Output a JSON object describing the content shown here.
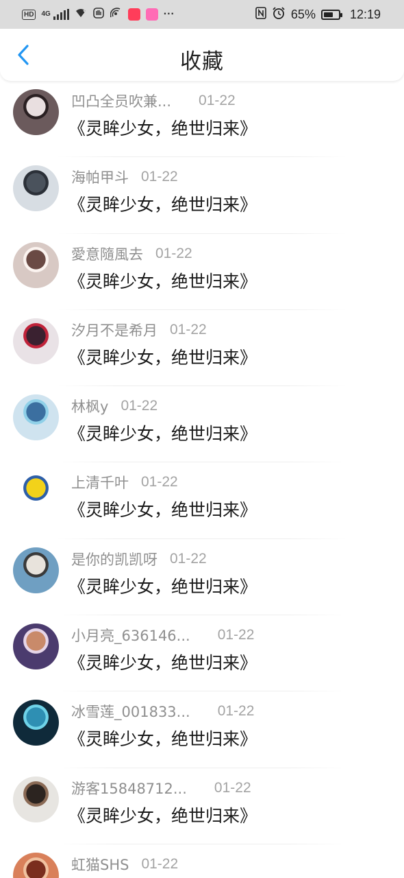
{
  "status_bar": {
    "hd": "HD",
    "network": "4G",
    "battery_percent": "65%",
    "battery_level": 0.65,
    "time": "12:19",
    "more": "···",
    "icons": [
      "hd-icon",
      "signal-icon",
      "wifi-icon",
      "hand-icon",
      "hotspot-icon",
      "app-icon-red",
      "app-icon-pink",
      "nfc-icon",
      "alarm-icon",
      "battery-icon"
    ]
  },
  "header": {
    "title": "收藏",
    "back_icon": "chevron-left-icon",
    "accent_color": "#2196f3"
  },
  "items": [
    {
      "name": "凹凸全员吹兼...",
      "date": "01-22",
      "content": "《灵眸少女，绝世归来》",
      "avatar": {
        "bg": "#6b5a5c",
        "fg": "#e9dfe0",
        "accent": "#2a2022"
      }
    },
    {
      "name": "海帕甲斗",
      "date": "01-22",
      "content": "《灵眸少女，绝世归来》",
      "avatar": {
        "bg": "#d7dde3",
        "fg": "#4a525c",
        "accent": "#2b3038"
      }
    },
    {
      "name": "愛意隨風去",
      "date": "01-22",
      "content": "《灵眸少女，绝世归来》",
      "avatar": {
        "bg": "#d8c9c4",
        "fg": "#6a4a44",
        "accent": "#fbf3ef"
      }
    },
    {
      "name": "汐月不是希月",
      "date": "01-22",
      "content": "《灵眸少女，绝世归来》",
      "avatar": {
        "bg": "#e9e2e6",
        "fg": "#3a2130",
        "accent": "#c0233a"
      }
    },
    {
      "name": "林枫y",
      "date": "01-22",
      "content": "《灵眸少女，绝世归来》",
      "avatar": {
        "bg": "#cfe3ef",
        "fg": "#3b6fa0",
        "accent": "#8fd0e8"
      }
    },
    {
      "name": "上清千叶",
      "date": "01-22",
      "content": "《灵眸少女，绝世归来》",
      "avatar": {
        "bg": "#ffffff",
        "fg": "#f2d21a",
        "accent": "#2d5fa8"
      }
    },
    {
      "name": "是你的凯凯呀",
      "date": "01-22",
      "content": "《灵眸少女，绝世归来》",
      "avatar": {
        "bg": "#6f9fc2",
        "fg": "#e8e3dc",
        "accent": "#3a3a3a"
      }
    },
    {
      "name": "小月亮_636146...",
      "date": "01-22",
      "content": "《灵眸少女，绝世归来》",
      "avatar": {
        "bg": "#4b3b6e",
        "fg": "#c98a6a",
        "accent": "#e6d5e8"
      }
    },
    {
      "name": "冰雪莲_001833...",
      "date": "01-22",
      "content": "《灵眸少女，绝世归来》",
      "avatar": {
        "bg": "#0f2a3a",
        "fg": "#2e8fb3",
        "accent": "#6fd3e8"
      }
    },
    {
      "name": "游客15848712...",
      "date": "01-22",
      "content": "《灵眸少女，绝世归来》",
      "avatar": {
        "bg": "#e7e5e1",
        "fg": "#2c2420",
        "accent": "#8a6a55"
      }
    },
    {
      "name": "虹猫SHS",
      "date": "01-22",
      "content": "",
      "avatar": {
        "bg": "#d9805a",
        "fg": "#7a2e1e",
        "accent": "#f0c2a0"
      }
    }
  ]
}
